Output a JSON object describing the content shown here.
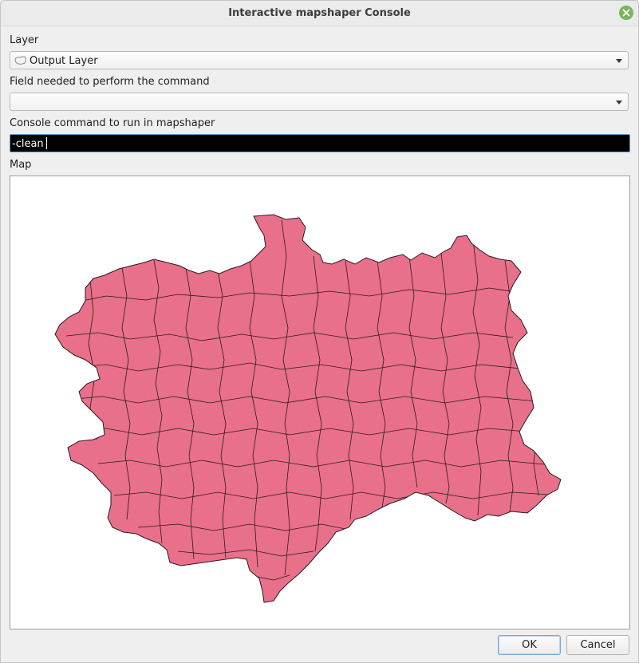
{
  "window": {
    "title": "Interactive mapshaper Console"
  },
  "layer": {
    "label": "Layer",
    "selected": "Output Layer"
  },
  "field": {
    "label": "Field needed to perform the command",
    "selected": ""
  },
  "command": {
    "label": "Console command to run in mapshaper",
    "value": "-clean"
  },
  "map": {
    "label": "Map",
    "fill_color": "#e8708a",
    "stroke_color": "#2a1a1e"
  },
  "buttons": {
    "ok": "OK",
    "cancel": "Cancel"
  },
  "colors": {
    "close_button": "#7ab55c",
    "accent": "#5b9bd5"
  },
  "icons": {
    "close": "close-icon",
    "layer": "polygon-layer-icon"
  }
}
